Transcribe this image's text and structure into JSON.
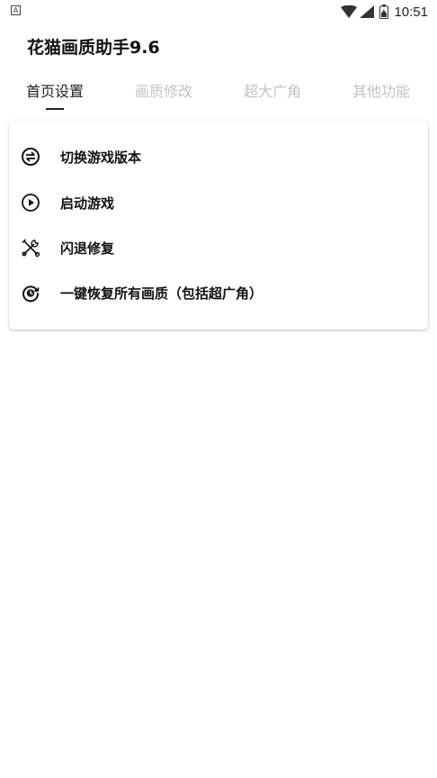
{
  "status_bar": {
    "app_icon": "A",
    "time": "10:51"
  },
  "app": {
    "title": "花猫画质助手9.6"
  },
  "tabs": [
    {
      "label": "首页设置"
    },
    {
      "label": "画质修改"
    },
    {
      "label": "超大广角"
    },
    {
      "label": "其他功能"
    }
  ],
  "menu": {
    "items": [
      {
        "label": "切换游戏版本",
        "icon": "switch-icon"
      },
      {
        "label": "启动游戏",
        "icon": "play-icon"
      },
      {
        "label": "闪退修复",
        "icon": "tools-icon"
      },
      {
        "label": "一键恢复所有画质（包括超广角）",
        "icon": "restore-icon"
      }
    ]
  },
  "colors": {
    "active_text": "#222222",
    "inactive_tab": "#c2c2c2",
    "background": "#ffffff"
  }
}
